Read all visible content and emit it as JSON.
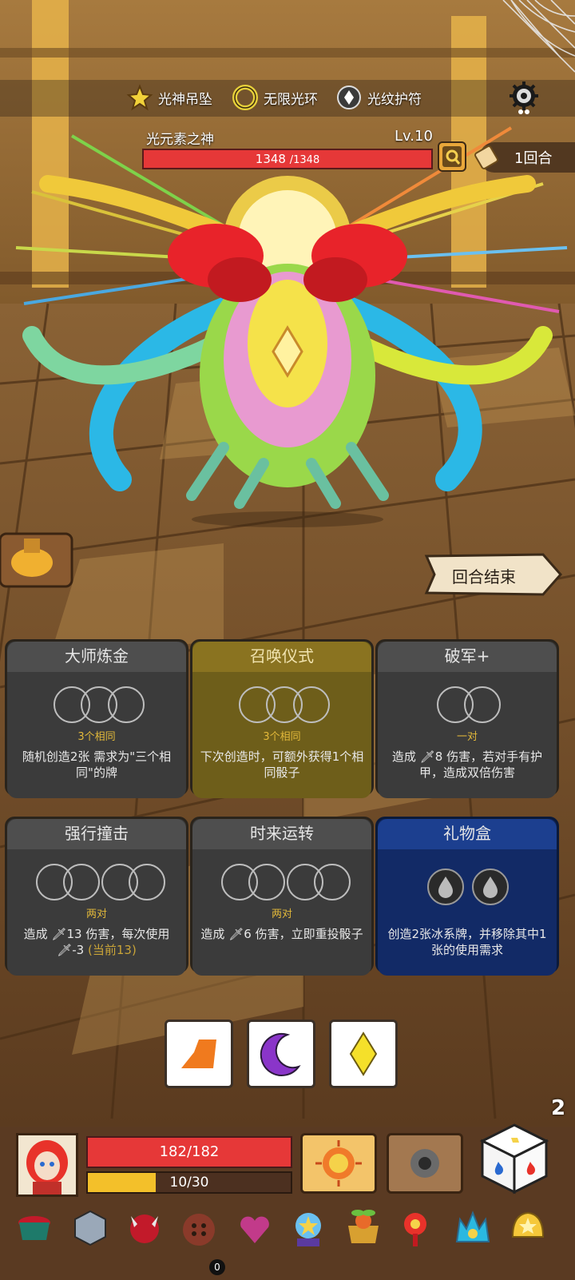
{
  "relics_top": [
    {
      "label": "光神吊坠",
      "icon": "star-pendant-icon"
    },
    {
      "label": "无限光环",
      "icon": "halo-ring-icon"
    },
    {
      "label": "光纹护符",
      "icon": "amulet-icon"
    }
  ],
  "boss": {
    "name": "光元素之神",
    "level": "Lv.10",
    "hp_current": "1348",
    "hp_max": "/1348",
    "hp_fraction": 1.0
  },
  "turn": {
    "label": "1回合"
  },
  "end_turn": {
    "label": "回合结束"
  },
  "cards": [
    {
      "title": "大师炼金",
      "req": "3个相同",
      "desc": "随机创造2张 需求为\"三个相同\"的牌",
      "style": "dark"
    },
    {
      "title": "召唤仪式",
      "req": "3个相同",
      "desc": "下次创造时，可额外获得1个相同骰子",
      "style": "gold"
    },
    {
      "title": "破军+",
      "req": "一对",
      "desc_prefix": "造成",
      "desc_value": "8",
      "desc_suffix": "伤害，若对手有护甲，造成双倍伤害",
      "style": "dark"
    },
    {
      "title": "强行撞击",
      "req": "两对",
      "desc_prefix": "造成",
      "desc_value": "13",
      "desc_mid": "伤害，每次使用",
      "desc_tail_value": "-3",
      "desc_current": "(当前13)",
      "style": "dark"
    },
    {
      "title": "时来运转",
      "req": "两对",
      "desc_prefix": "造成",
      "desc_value": "6",
      "desc_suffix": "伤害，立即重投骰子",
      "style": "dark"
    },
    {
      "title": "礼物盒",
      "desc": "创造2张冰系牌，并移除其中1张的使用需求",
      "style": "blue"
    }
  ],
  "dice": [
    {
      "icon": "orange-shape-icon",
      "color": "#f07a1e"
    },
    {
      "icon": "crescent-moon-icon",
      "color": "#8a35c9"
    },
    {
      "icon": "yellow-diamond-icon",
      "color": "#f5e02a"
    }
  ],
  "player": {
    "hp": "182/182",
    "hp_fraction": 1.0,
    "xp": "10/30",
    "xp_fraction": 0.333
  },
  "reroll_count": "2",
  "relic_badge": "0",
  "colors": {
    "hp_red": "#e63838",
    "xp_yellow": "#f3c02a",
    "accent_gold": "#e3b93a"
  }
}
